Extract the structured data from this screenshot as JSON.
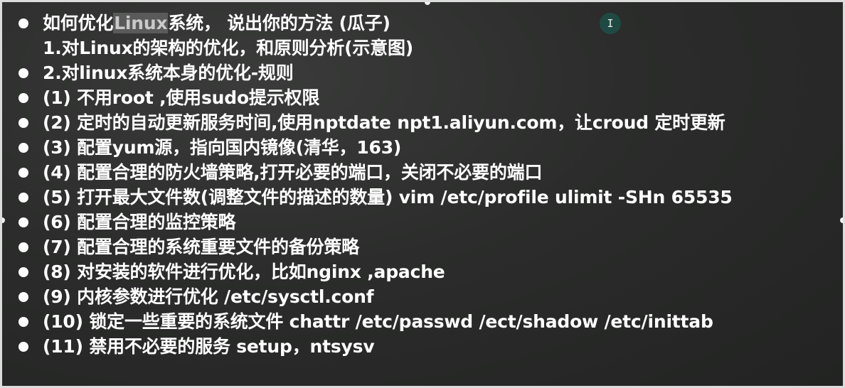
{
  "slide": {
    "lines": [
      {
        "bullet": true,
        "pre": "如何优化",
        "highlight": "Linux",
        "post": "系统， 说出你的方法 (瓜子)"
      },
      {
        "bullet": false,
        "text": "1.对Linux的架构的优化，和原则分析(示意图)"
      },
      {
        "bullet": true,
        "text": "2.对linux系统本身的优化-规则"
      },
      {
        "bullet": true,
        "text": "(1) 不用root ,使用sudo提示权限"
      },
      {
        "bullet": true,
        "text": "(2) 定时的自动更新服务时间,使用nptdate npt1.aliyun.com，让croud 定时更新"
      },
      {
        "bullet": true,
        "text": "(3) 配置yum源，指向国内镜像(清华，163)"
      },
      {
        "bullet": true,
        "text": "(4) 配置合理的防火墙策略,打开必要的端口，关闭不必要的端口"
      },
      {
        "bullet": true,
        "text": "(5) 打开最大文件数(调整文件的描述的数量) vim /etc/profile ulimit -SHn 65535"
      },
      {
        "bullet": true,
        "text": "(6) 配置合理的监控策略"
      },
      {
        "bullet": true,
        "text": "(7) 配置合理的系统重要文件的备份策略"
      },
      {
        "bullet": true,
        "text": "(8) 对安装的软件进行优化，比如nginx ,apache"
      },
      {
        "bullet": true,
        "text": "(9) 内核参数进行优化 /etc/sysctl.conf"
      },
      {
        "bullet": true,
        "text": "(10) 锁定一些重要的系统文件 chattr /etc/passwd /ect/shadow /etc/inittab"
      },
      {
        "bullet": true,
        "text": "(11) 禁用不必要的服务 setup，ntsysv"
      }
    ]
  },
  "cursor": {
    "glyph": "I"
  },
  "colors": {
    "background": "#2b2c2b",
    "text": "#ffffff",
    "highlight": "#5a5a5a",
    "cursor": "#1f4a43"
  }
}
